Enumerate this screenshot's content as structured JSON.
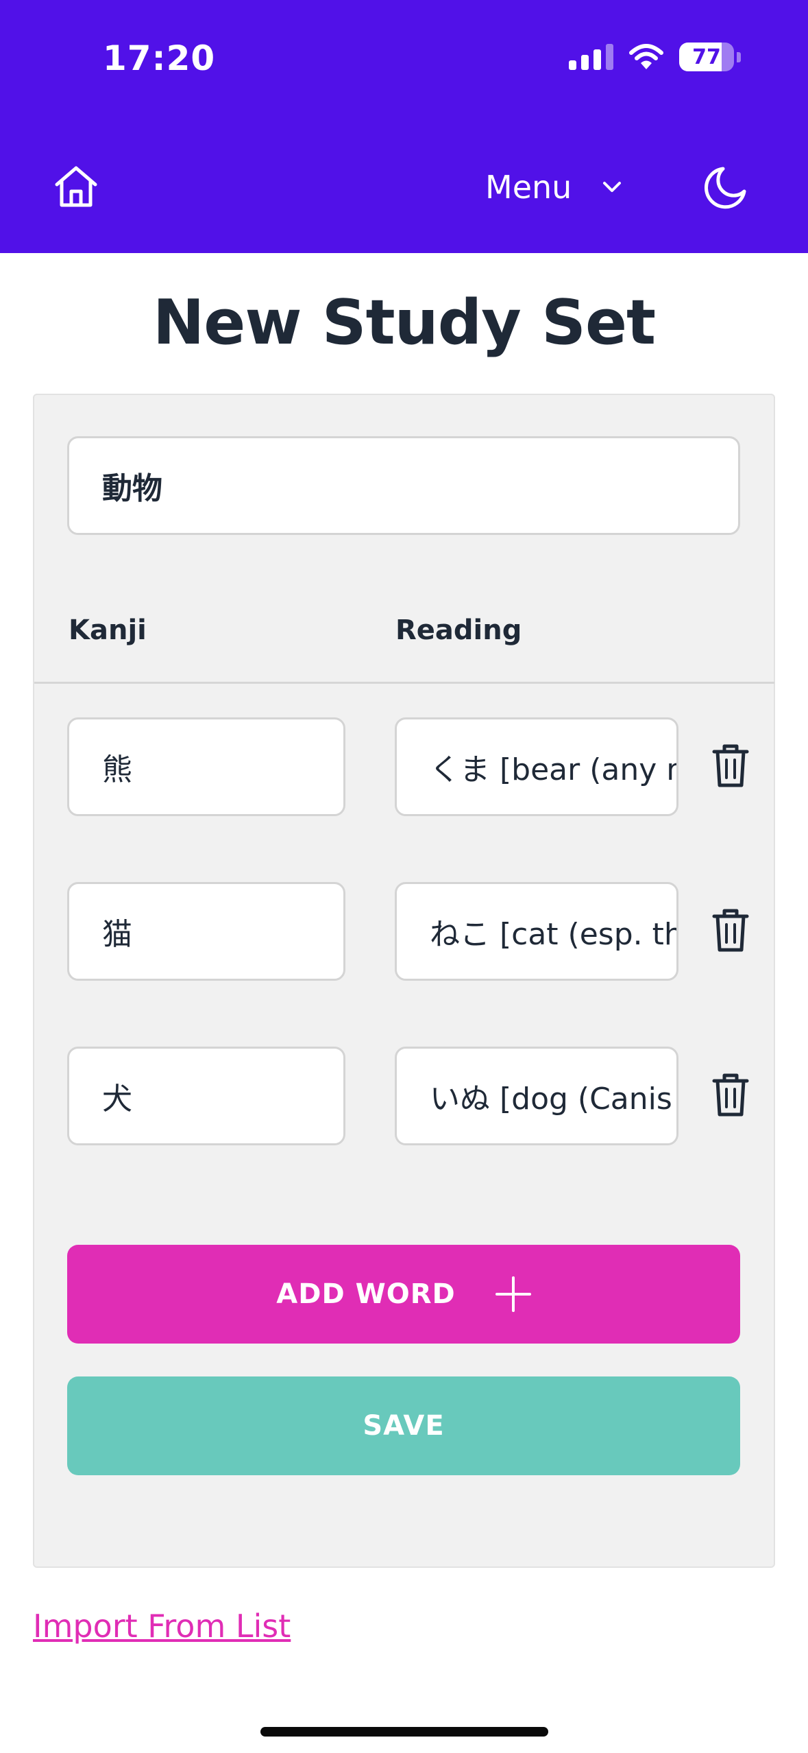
{
  "status_bar": {
    "time": "17:20",
    "battery_level": "77",
    "battery_fraction": 0.77,
    "signal_bars_active": 3,
    "icons": [
      "cellular-signal-icon",
      "wifi-icon",
      "battery-icon"
    ]
  },
  "header": {
    "background_color": "#5111e8",
    "home_icon": "home-icon",
    "menu_label": "Menu",
    "menu_icon": "chevron-down-icon",
    "theme_icon": "moon-icon"
  },
  "page": {
    "title": "New Study Set"
  },
  "form": {
    "set_name_value": "動物",
    "columns": {
      "kanji": "Kanji",
      "reading": "Reading"
    },
    "words": [
      {
        "kanji": "熊",
        "reading": "くま [bear (any mammal of family Ursidae)]"
      },
      {
        "kanji": "猫",
        "reading": "ねこ [cat (esp. the domestic cat)]"
      },
      {
        "kanji": "犬",
        "reading": "いぬ [dog (Canis familiaris)]"
      }
    ],
    "delete_icon": "trash-icon",
    "add_word_label": "ADD WORD",
    "add_icon": "plus-icon",
    "save_label": "SAVE"
  },
  "links": {
    "import_label": "Import From List"
  },
  "colors": {
    "accent_pink": "#e02db5",
    "save_teal": "#68c9bc",
    "card_bg": "#f1f1f1",
    "text_dark": "#1f2937"
  }
}
